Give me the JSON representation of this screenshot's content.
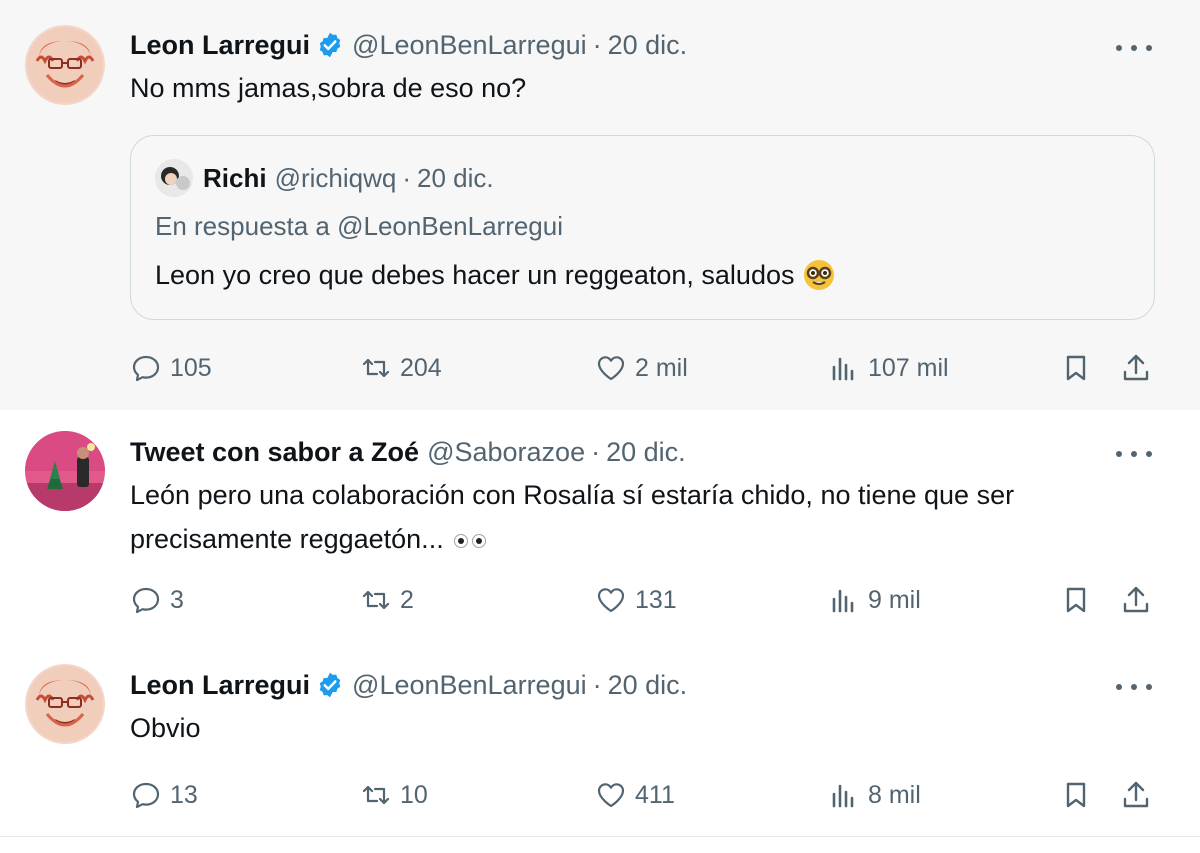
{
  "colors": {
    "verified": "#1d9bf0",
    "secondary_text": "#536471",
    "primary_text": "#0f1419",
    "highlight_bg": "#f7f7f7",
    "thread_line": "#cfd9de"
  },
  "tweets": [
    {
      "name": "Leon Larregui",
      "verified": true,
      "handle": "@LeonBenLarregui",
      "separator": "·",
      "date": "20 dic.",
      "text": "No mms jamas,sobra de eso no?",
      "quote": {
        "name": "Richi",
        "handle": "@richiqwq",
        "separator": "·",
        "date": "20 dic.",
        "reply_to": "En respuesta a @LeonBenLarregui",
        "text": "Leon yo creo que debes hacer un reggeaton, saludos",
        "emoji": "nerd-face-emoji"
      },
      "stats": {
        "replies": "105",
        "retweets": "204",
        "likes": "2 mil",
        "views": "107 mil"
      }
    },
    {
      "name": "Tweet con sabor a Zoé",
      "verified": false,
      "handle": "@Saborazoe",
      "separator": "·",
      "date": "20 dic.",
      "text_line1": "León pero una colaboración con Rosalía sí estaría chido, no tiene que ser",
      "text_line2": "precisamente reggaetón...",
      "emoji": "eyes-emoji",
      "stats": {
        "replies": "3",
        "retweets": "2",
        "likes": "131",
        "views": "9 mil"
      }
    },
    {
      "name": "Leon Larregui",
      "verified": true,
      "handle": "@LeonBenLarregui",
      "separator": "·",
      "date": "20 dic.",
      "text": "Obvio",
      "stats": {
        "replies": "13",
        "retweets": "10",
        "likes": "411",
        "views": "8 mil"
      }
    }
  ]
}
